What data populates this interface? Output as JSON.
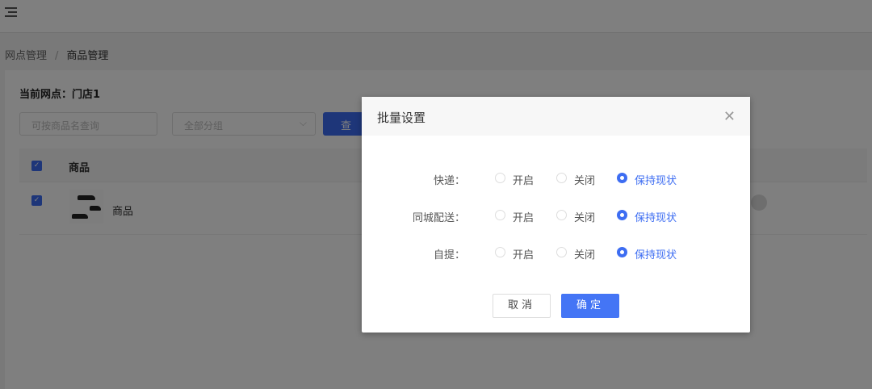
{
  "breadcrumb": {
    "items": [
      "网点管理",
      "商品管理"
    ],
    "separator": "/"
  },
  "store": {
    "label": "当前网点：门店1"
  },
  "filters": {
    "search_placeholder": "可按商品名查询",
    "group_placeholder": "全部分组",
    "query_label": "查询"
  },
  "table": {
    "headers": [
      "商品"
    ],
    "rows": [
      {
        "name": "商品",
        "checked": true
      }
    ],
    "header_checked": true
  },
  "modal": {
    "title": "批量设置",
    "rows": [
      {
        "label": "快递：",
        "options": [
          "开启",
          "关闭",
          "保持现状"
        ],
        "selected": "保持现状"
      },
      {
        "label": "同城配送：",
        "options": [
          "开启",
          "关闭",
          "保持现状"
        ],
        "selected": "保持现状"
      },
      {
        "label": "自提：",
        "options": [
          "开启",
          "关闭",
          "保持现状"
        ],
        "selected": "保持现状"
      }
    ],
    "cancel_label": "取消",
    "ok_label": "确定"
  },
  "colors": {
    "accent": "#3d6df2",
    "overlay": "rgba(0,0,0,0.5)"
  }
}
